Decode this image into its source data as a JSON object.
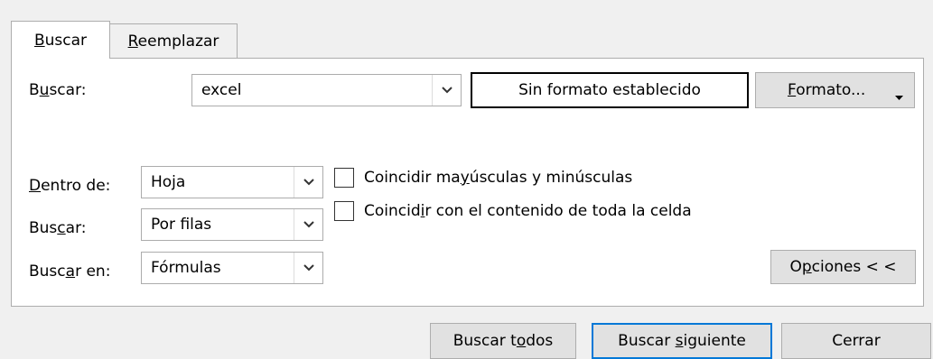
{
  "tabs": {
    "buscar": {
      "pre": "",
      "ul": "B",
      "post": "uscar"
    },
    "reemplazar": {
      "pre": "",
      "ul": "R",
      "post": "eemplazar"
    }
  },
  "search": {
    "label": {
      "pre": "B",
      "ul": "u",
      "post": "scar:"
    },
    "value": "excel",
    "format_preview": "Sin formato establecido",
    "format_button": {
      "pre": "",
      "ul": "F",
      "post": "ormato..."
    }
  },
  "options": {
    "within": {
      "label": {
        "pre": "",
        "ul": "D",
        "post": "entro de:"
      },
      "value": "Hoja"
    },
    "search_order": {
      "label": {
        "pre": "Bus",
        "ul": "c",
        "post": "ar:"
      },
      "value": "Por filas"
    },
    "look_in": {
      "label": {
        "pre": "Busc",
        "ul": "a",
        "post": "r en:"
      },
      "value": "Fórmulas"
    },
    "match_case": {
      "label": {
        "pre": "Coincidir ma",
        "ul": "y",
        "post": "úsculas y minúsculas"
      },
      "checked": false
    },
    "match_entire": {
      "label": {
        "pre": "Coincid",
        "ul": "i",
        "post": "r con el contenido de toda la celda"
      },
      "checked": false
    },
    "options_button": {
      "pre": "O",
      "ul": "p",
      "post": "ciones < <"
    }
  },
  "footer": {
    "find_all": {
      "pre": "Buscar t",
      "ul": "o",
      "post": "dos"
    },
    "find_next": {
      "pre": "Buscar ",
      "ul": "s",
      "post": "iguiente"
    },
    "close": "Cerrar"
  },
  "icons": {
    "dropdown": "chevron-down-icon",
    "format_dropdown": "caret-down-icon"
  }
}
